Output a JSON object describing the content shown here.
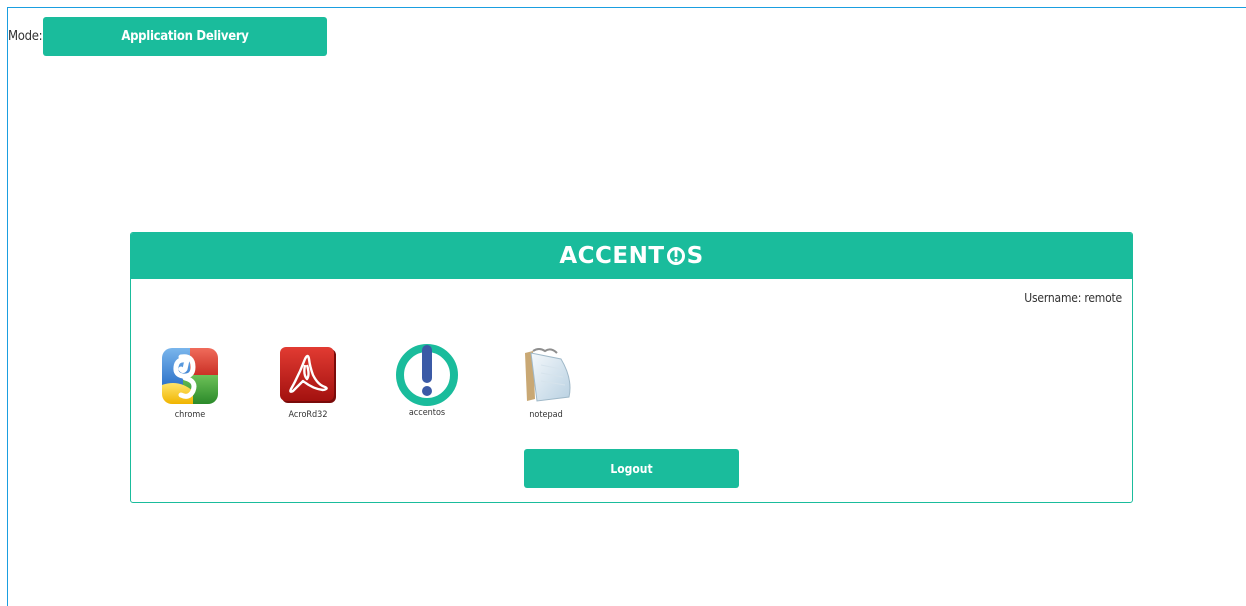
{
  "mode": {
    "label": "Mode:",
    "button_label": "Application Delivery"
  },
  "panel": {
    "logo_text_left": "ACCENT",
    "logo_text_right": "S",
    "username_label": "Username: remote",
    "apps": [
      {
        "label": "chrome",
        "icon": "chrome-icon"
      },
      {
        "label": "AcroRd32",
        "icon": "acrobat-reader-icon"
      },
      {
        "label": "accentos",
        "icon": "accentos-icon"
      },
      {
        "label": "notepad",
        "icon": "notepad-icon"
      }
    ],
    "logout_label": "Logout"
  },
  "colors": {
    "accent": "#1abc9c",
    "frame_border": "#1a9ee0"
  }
}
